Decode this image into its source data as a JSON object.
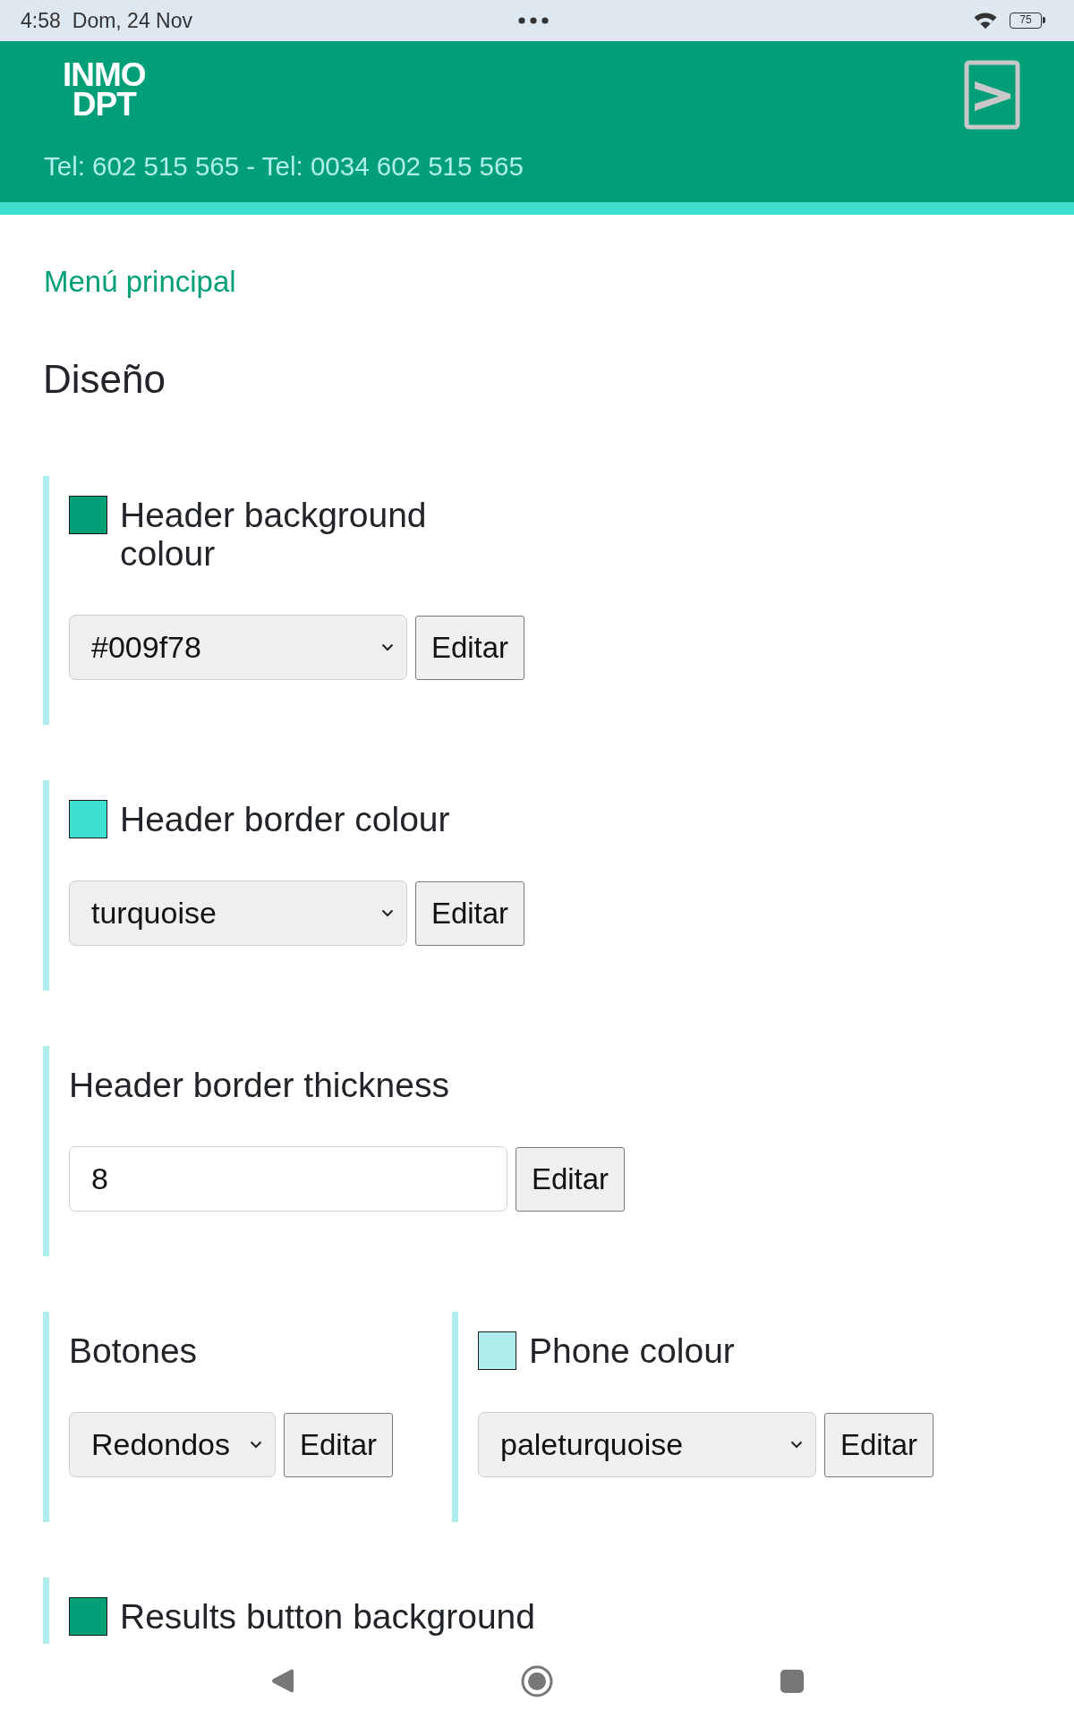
{
  "status_bar": {
    "time": "4:58",
    "date": "Dom, 24 Nov",
    "battery": "75"
  },
  "header": {
    "logo": [
      "INMO",
      "DPT"
    ],
    "phone_text": "Tel: 602 515 565 - Tel: 0034 602 515 565"
  },
  "main_menu_link": "Menú principal",
  "page_title": "Diseño",
  "settings_rows": [
    [
      {
        "kind": "color",
        "label": "Header background colour",
        "color": "#009f78",
        "value": "#009f78",
        "button": "Editar"
      }
    ],
    [
      {
        "kind": "color",
        "label": "Header border colour",
        "color": "#40e0d0",
        "value": "turquoise",
        "button": "Editar"
      }
    ],
    [
      {
        "kind": "text",
        "label": "Header border thickness",
        "value": "8",
        "button": "Editar"
      }
    ],
    [
      {
        "kind": "select",
        "label": "Botones",
        "value": "Redondos",
        "button": "Editar"
      },
      {
        "kind": "color",
        "label": "Phone colour",
        "color": "#afeeee",
        "value": "paleturquoise",
        "button": "Editar"
      }
    ],
    [
      {
        "kind": "color",
        "label": "Results button background",
        "color": "#009f78"
      }
    ]
  ]
}
